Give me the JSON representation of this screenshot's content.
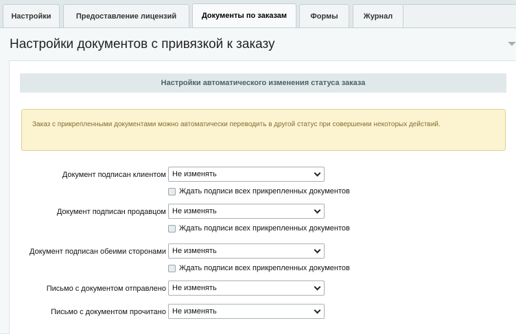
{
  "tabs": [
    {
      "label": "Настройки"
    },
    {
      "label": "Предоставление лицензий"
    },
    {
      "label": "Документы по заказам"
    },
    {
      "label": "Формы"
    },
    {
      "label": "Журнал"
    }
  ],
  "active_tab": "Документы по заказам",
  "panel": {
    "title": "Настройки документов с привязкой к заказу"
  },
  "section": {
    "heading": "Настройки автоматического изменения статуса заказа",
    "notice": "Заказ с прикрепленными документами можно автоматически переводить в другой статус при совершении некоторых действий."
  },
  "rows": [
    {
      "label": "Документ подписан клиентом",
      "value": "Не изменять"
    },
    {
      "label": "Документ подписан продавцом",
      "value": "Не изменять"
    },
    {
      "label": "Документ подписан обеими сторонами",
      "value": "Не изменять"
    },
    {
      "label": "Письмо с документом отправлено",
      "value": "Не изменять"
    },
    {
      "label": "Письмо с документом прочитано",
      "value": "Не изменять"
    }
  ],
  "wait_checkbox_label": "Ждать подписи всех прикрепленных документов"
}
